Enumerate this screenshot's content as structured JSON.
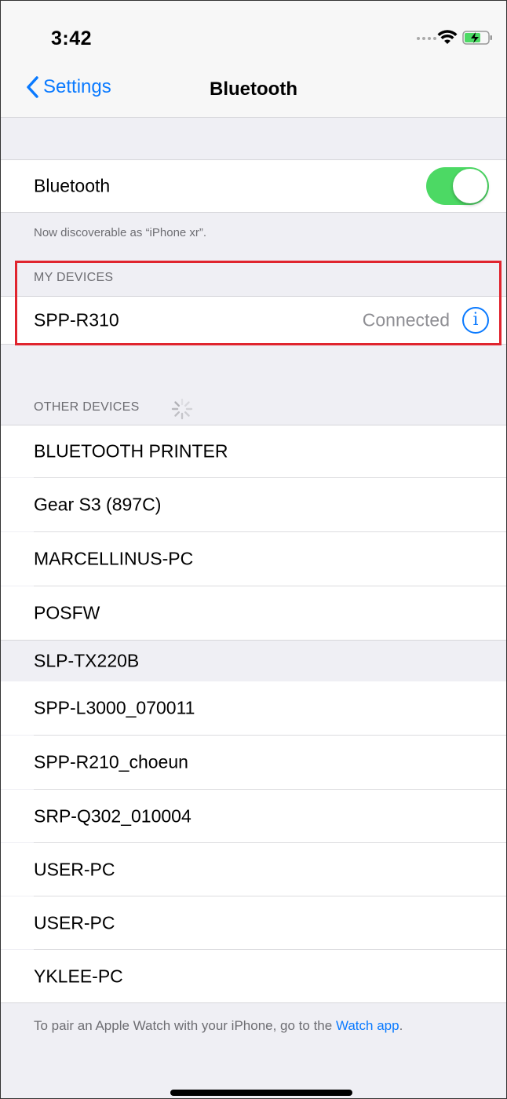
{
  "status_bar": {
    "time": "3:42"
  },
  "nav": {
    "back_label": "Settings",
    "title": "Bluetooth"
  },
  "bluetooth_toggle": {
    "label": "Bluetooth",
    "on": true
  },
  "discoverable_note": "Now discoverable as “iPhone xr”.",
  "my_devices": {
    "header": "MY DEVICES",
    "items": [
      {
        "name": "SPP-R310",
        "status": "Connected"
      }
    ]
  },
  "other_devices": {
    "header": "OTHER DEVICES",
    "items": [
      "BLUETOOTH PRINTER",
      "Gear S3 (897C)",
      "MARCELLINUS-PC",
      "POSFW",
      "SLP-TX220B",
      "SPP-L3000_070011",
      "SPP-R210_choeun",
      "SRP-Q302_010004",
      "USER-PC",
      "USER-PC",
      "YKLEE-PC"
    ]
  },
  "footer": {
    "text_before_link": "To pair an Apple Watch with your iPhone, go to the ",
    "link_text": "Watch app",
    "text_after_link": "."
  },
  "colors": {
    "accent": "#0a7aff",
    "toggle_on": "#4cd964",
    "highlight": "#e0242e"
  }
}
